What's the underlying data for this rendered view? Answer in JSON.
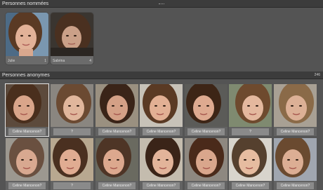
{
  "named_section": {
    "title": "Personnes nommées"
  },
  "named": [
    {
      "name": "Julie",
      "count": "1"
    },
    {
      "name": "Sabrina",
      "count": "4"
    }
  ],
  "anon_section": {
    "title": "Personnes anonymes",
    "count": "246"
  },
  "anon": [
    {
      "label": "Celine Mancenon?"
    },
    {
      "label": "?"
    },
    {
      "label": "Celine Mancenon?"
    },
    {
      "label": "Celine Mancenon?"
    },
    {
      "label": "Celine Mancenon?"
    },
    {
      "label": "?"
    },
    {
      "label": "Celine Mancenon?"
    },
    {
      "label": "Celine Mancenon?"
    },
    {
      "label": "?"
    },
    {
      "label": "Celine Mancenon?"
    },
    {
      "label": "Celine Mancenon?"
    },
    {
      "label": "Celine Mancenon?"
    },
    {
      "label": "Celine Mancenon?"
    },
    {
      "label": "Celine Mancenon?"
    }
  ]
}
